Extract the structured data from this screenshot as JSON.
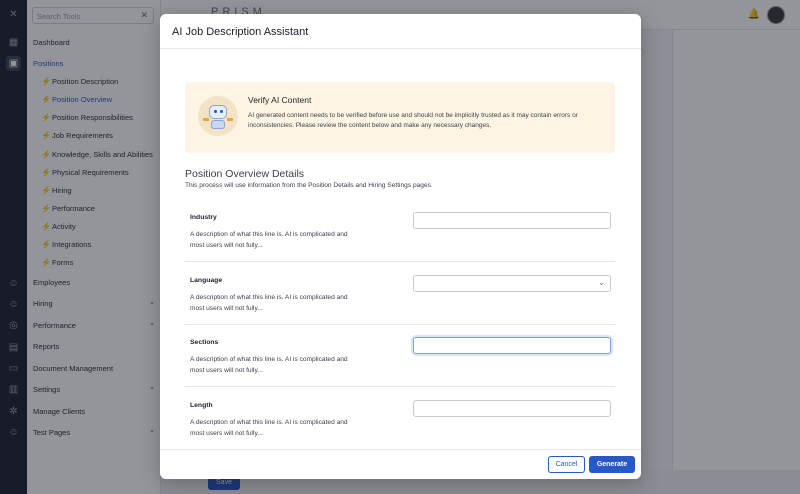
{
  "sidebar": {
    "search_placeholder": "Search Tools",
    "close_glyph": "✕",
    "items": {
      "dashboard": "Dashboard",
      "positions": "Positions",
      "employees": "Employees",
      "hiring": "Hiring",
      "performance": "Performance",
      "reports": "Reports",
      "document_management": "Document Management",
      "settings": "Settings",
      "manage_clients": "Manage Clients",
      "test_pages": "Test Pages"
    },
    "position_subitems": [
      "Position Description",
      "Position Overview",
      "Position Responsibilities",
      "Job Requirements",
      "Knowledge, Skills and Abilities",
      "Physical Requirements",
      "Hiring",
      "Performance",
      "Activity",
      "Integrations",
      "Forms"
    ]
  },
  "topbar": {
    "logo": "PRISM"
  },
  "bottombar": {
    "save_label": "Save"
  },
  "modal": {
    "title": "AI Job Description Assistant",
    "notice": {
      "title": "Verify AI Content",
      "text": "AI generated content needs to be verified before use and should not be implicitly trusted as it may contain errors or inconsistencies. Please review the content below and make any necessary changes."
    },
    "section_title": "Position Overview Details",
    "section_subtitle": "This process will use information from the Position Details and Hiring Settings pages.",
    "fields": [
      {
        "label": "Industry",
        "description": "A description of what this line is. AI is complicated and most users will not fully...",
        "value": ""
      },
      {
        "label": "Language",
        "description": "A description of what this line is. AI is complicated and most users will not fully...",
        "value": ""
      },
      {
        "label": "Sections",
        "description": "A description of what this line is. AI is complicated and most users will not fully...",
        "value": ""
      },
      {
        "label": "Length",
        "description": "A description of what this line is. AI is complicated and most users will not fully...",
        "value": ""
      }
    ],
    "cancel_label": "Cancel",
    "generate_label": "Generate"
  },
  "colors": {
    "accent": "#2857c6",
    "notice_bg": "#fdf4e3",
    "rail": "#1f2433"
  },
  "icons": [
    "close-icon",
    "grid-icon",
    "briefcase-icon",
    "person-icon",
    "bell-icon",
    "bolt-icon",
    "chevron-down-icon",
    "robot-icon"
  ]
}
